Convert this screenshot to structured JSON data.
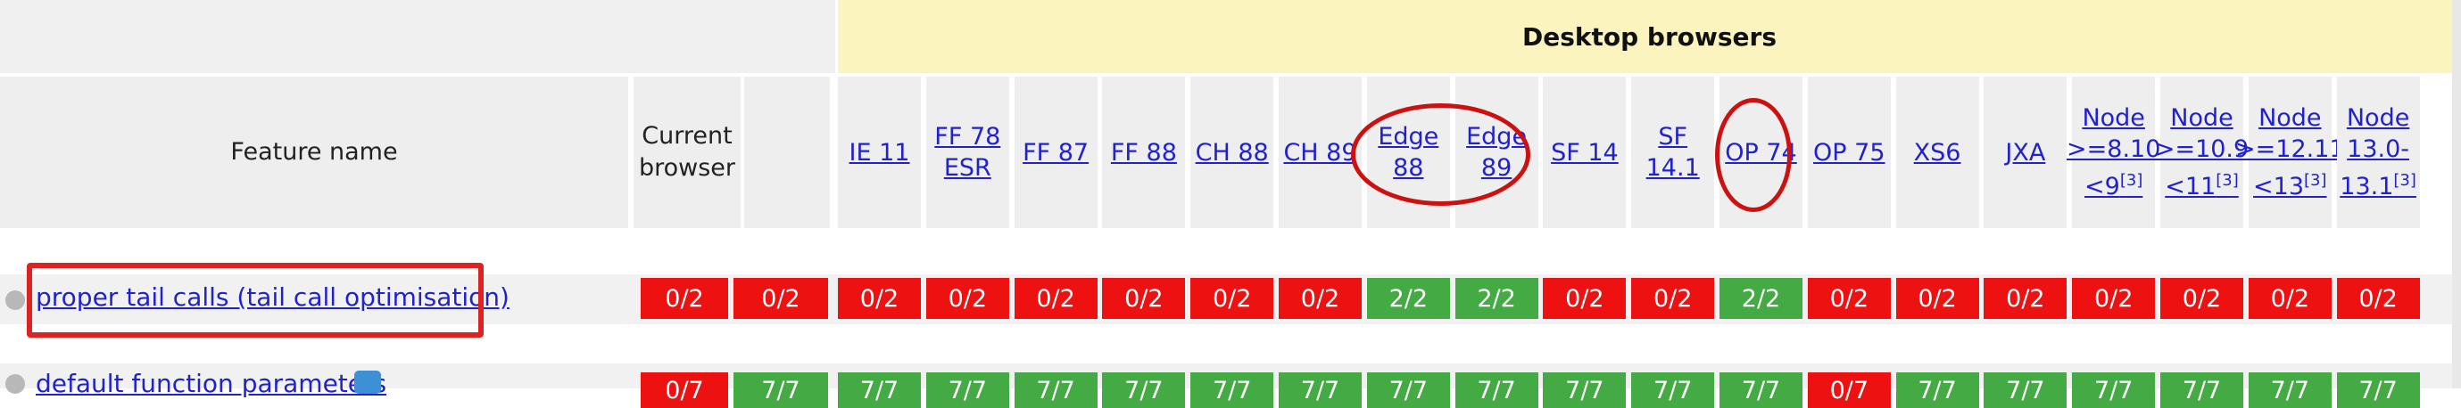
{
  "header_group": {
    "label": "Desktop browsers"
  },
  "columns": {
    "feature": "Feature name",
    "current": "Current browser"
  },
  "browsers": [
    {
      "name": "IE 11"
    },
    {
      "name": "FF 78 ESR"
    },
    {
      "name": "FF 87"
    },
    {
      "name": "FF 88"
    },
    {
      "name": "CH 88"
    },
    {
      "name": "CH 89"
    },
    {
      "name": "Edge 88"
    },
    {
      "name": "Edge 89"
    },
    {
      "name": "SF 14"
    },
    {
      "name": "SF 14.1"
    },
    {
      "name": "OP 74"
    },
    {
      "name": "OP 75"
    },
    {
      "name": "XS6"
    },
    {
      "name": "JXA"
    },
    {
      "name": "Node >=8.10 <9",
      "note": "[3]"
    },
    {
      "name": "Node >=10.9 <11",
      "note": "[3]"
    },
    {
      "name": "Node >=12.11 <13",
      "note": "[3]"
    },
    {
      "name": "Node 13.0-13.1",
      "note": "[3]"
    }
  ],
  "rows": [
    {
      "feature": "proper tail calls (tail call optimisation)",
      "current": "0/2",
      "blank": "0/2",
      "results": [
        "0/2",
        "0/2",
        "0/2",
        "0/2",
        "0/2",
        "0/2",
        "2/2",
        "2/2",
        "0/2",
        "0/2",
        "2/2",
        "0/2",
        "0/2",
        "0/2",
        "0/2",
        "0/2",
        "0/2",
        "0/2"
      ],
      "status": [
        "fail",
        "fail",
        "fail",
        "fail",
        "fail",
        "fail",
        "pass",
        "pass",
        "fail",
        "fail",
        "pass",
        "fail",
        "fail",
        "fail",
        "fail",
        "fail",
        "fail",
        "fail"
      ]
    },
    {
      "feature": "default function parameters",
      "current": "0/7",
      "blank": "7/7",
      "results": [
        "7/7",
        "7/7",
        "7/7",
        "7/7",
        "7/7",
        "7/7",
        "7/7",
        "7/7",
        "7/7",
        "7/7",
        "7/7",
        "0/7",
        "7/7",
        "7/7",
        "7/7",
        "7/7",
        "7/7",
        "7/7"
      ],
      "status": [
        "pass",
        "pass",
        "pass",
        "pass",
        "pass",
        "pass",
        "pass",
        "pass",
        "pass",
        "pass",
        "pass",
        "fail",
        "pass",
        "pass",
        "pass",
        "pass",
        "pass",
        "pass"
      ]
    }
  ],
  "colors": {
    "pass": "#44aa44",
    "fail": "#ee1111",
    "link": "#2222cc",
    "header_yellow": "#fcf4bf",
    "highlight": "#dd2222"
  }
}
